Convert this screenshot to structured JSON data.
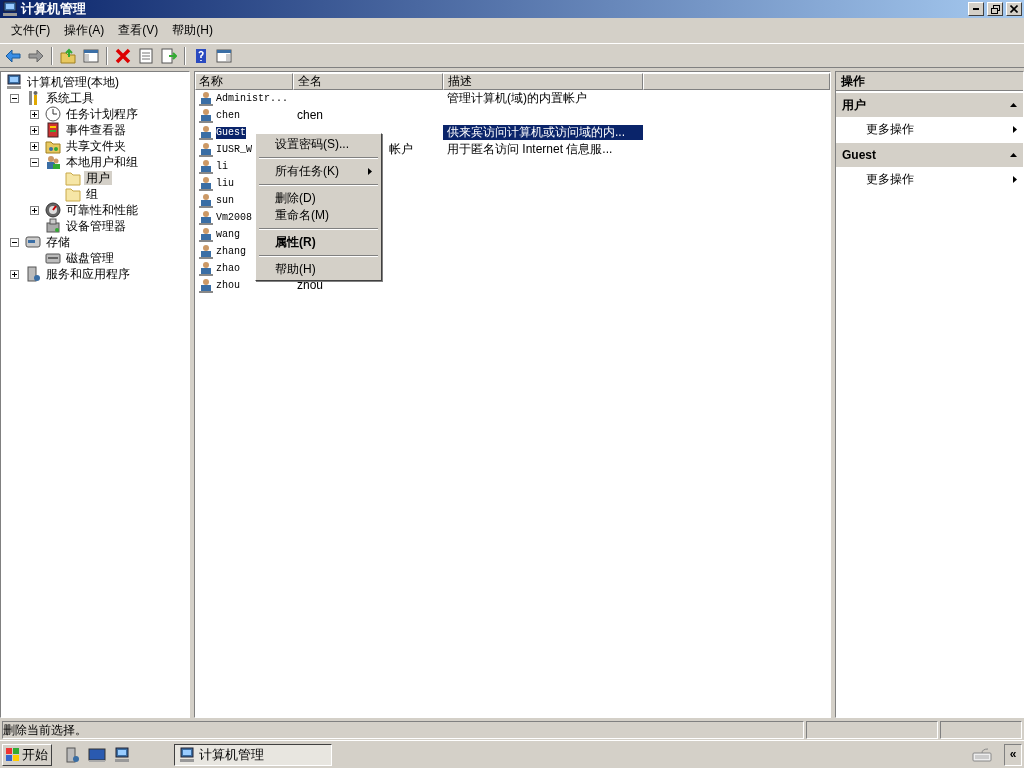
{
  "window": {
    "title": "计算机管理"
  },
  "menu": [
    "文件(F)",
    "操作(A)",
    "查看(V)",
    "帮助(H)"
  ],
  "tree": [
    {
      "label": "计算机管理(本地)",
      "kind": "computer",
      "selected": false,
      "children": [
        {
          "label": "系统工具",
          "kind": "tools",
          "expanded": true,
          "selected": false,
          "children": [
            {
              "label": "任务计划程序",
              "kind": "clock",
              "expanded": false,
              "selected": false
            },
            {
              "label": "事件查看器",
              "kind": "log",
              "expanded": false,
              "selected": false
            },
            {
              "label": "共享文件夹",
              "kind": "share",
              "expanded": false,
              "selected": false
            },
            {
              "label": "本地用户和组",
              "kind": "users",
              "expanded": true,
              "selected": false,
              "children": [
                {
                  "label": "用户",
                  "kind": "folder",
                  "selected": true
                },
                {
                  "label": "组",
                  "kind": "folder",
                  "selected": false
                }
              ]
            },
            {
              "label": "可靠性和性能",
              "kind": "gauge",
              "expanded": false,
              "selected": false
            },
            {
              "label": "设备管理器",
              "kind": "device",
              "selected": false
            }
          ]
        },
        {
          "label": "存储",
          "kind": "storage",
          "expanded": true,
          "selected": false,
          "children": [
            {
              "label": "磁盘管理",
              "kind": "disk",
              "selected": false
            }
          ]
        },
        {
          "label": "服务和应用程序",
          "kind": "services",
          "expanded": false,
          "selected": false
        }
      ]
    }
  ],
  "list": {
    "columns": [
      "名称",
      "全名",
      "描述"
    ],
    "rows": [
      {
        "name": "Administr...",
        "description": "管理计算机(域)的内置帐户",
        "selected": false
      },
      {
        "name": "chen",
        "fullname": "chen",
        "selected": false
      },
      {
        "name": "Guest",
        "description": "供来宾访问计算机或访问域的内...",
        "selected": true
      },
      {
        "name": "IUSR_W",
        "fullname": "帐户",
        "fullname_cut": true,
        "description": "用于匿名访问 Internet 信息服...",
        "selected": false
      },
      {
        "name": "li",
        "selected": false
      },
      {
        "name": "liu",
        "selected": false
      },
      {
        "name": "sun",
        "selected": false
      },
      {
        "name": "Vm2008",
        "selected": false
      },
      {
        "name": "wang",
        "selected": false
      },
      {
        "name": "zhang",
        "selected": false
      },
      {
        "name": "zhao",
        "selected": false
      },
      {
        "name": "zhou",
        "fullname": "zhou",
        "selected": false
      }
    ]
  },
  "context_menu": [
    {
      "label": "设置密码(S)...",
      "submenu": false,
      "default": false
    },
    {
      "kind": "separator"
    },
    {
      "label": "所有任务(K)",
      "submenu": true,
      "default": false
    },
    {
      "kind": "separator"
    },
    {
      "label": "删除(D)",
      "submenu": false,
      "default": false
    },
    {
      "label": "重命名(M)",
      "submenu": false,
      "default": false
    },
    {
      "kind": "separator"
    },
    {
      "label": "属性(R)",
      "submenu": false,
      "default": true
    },
    {
      "kind": "separator"
    },
    {
      "label": "帮助(H)",
      "submenu": false,
      "default": false
    }
  ],
  "actions": {
    "title": "操作",
    "sections": [
      {
        "title": "用户",
        "items": [
          "更多操作"
        ]
      },
      {
        "title": "Guest",
        "items": [
          "更多操作"
        ]
      }
    ]
  },
  "status_bar": {
    "text": "删除当前选择。"
  },
  "taskbar": {
    "start": "开始",
    "tasks": [
      {
        "label": "计算机管理",
        "selected": true
      }
    ],
    "show_hidden": "«"
  }
}
